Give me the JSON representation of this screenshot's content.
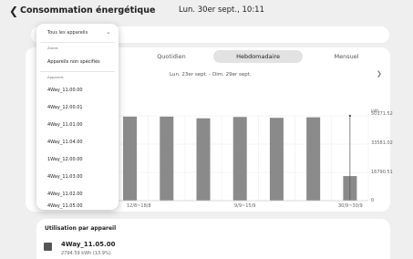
{
  "header": {
    "back_icon": "chevron-left-icon",
    "title": "Consommation énergétique",
    "datetime": "Lun. 30er sept., 10:11"
  },
  "tabs": {
    "daily": "Quotidien",
    "weekly": "Hebdomadaire",
    "monthly": "Mensuel",
    "active": "Hebdomadaire"
  },
  "range": {
    "label": "Lun. 23er sept. - Dim. 29er sept.",
    "next_icon": "chevron-right-icon"
  },
  "chart_data": {
    "type": "bar",
    "unit": "kWh",
    "x_tick_labels": [
      "12/8~18/8",
      "9/9~15/9",
      "30/9~30/9"
    ],
    "y_ticks": [
      0,
      16790.51,
      33581.02,
      50371.52
    ],
    "ylim": [
      0,
      50371.52
    ],
    "values": [
      49300,
      50371.52,
      49900,
      49900,
      48900,
      49700,
      49200,
      49500,
      14600
    ],
    "highlight_index": 8,
    "bar_color": "#8a8a8a",
    "grid": true
  },
  "dropdown": {
    "selected": "Tous les appareils",
    "zones_label": "Zones",
    "zones_items": [
      "Appareils non spécifiés"
    ],
    "devices_label": "Appareils",
    "devices": [
      "4Way_11.00.00",
      "4Way_12.00.01",
      "4Way_11.01.00",
      "4Way_11.04.00",
      "1Way_12.00.00",
      "4Way_11.03.00",
      "4Way_11.02.00",
      "4Way_11.05.00"
    ]
  },
  "usage": {
    "title": "Utilisation par appareil",
    "device_name": "4Way_11.05.00",
    "device_value": "2794.59 kWh (13.9%)"
  },
  "colors": {
    "background": "#efefef",
    "card": "#ffffff",
    "bar": "#8a8a8a",
    "active_tab": "#e2e2e2"
  }
}
